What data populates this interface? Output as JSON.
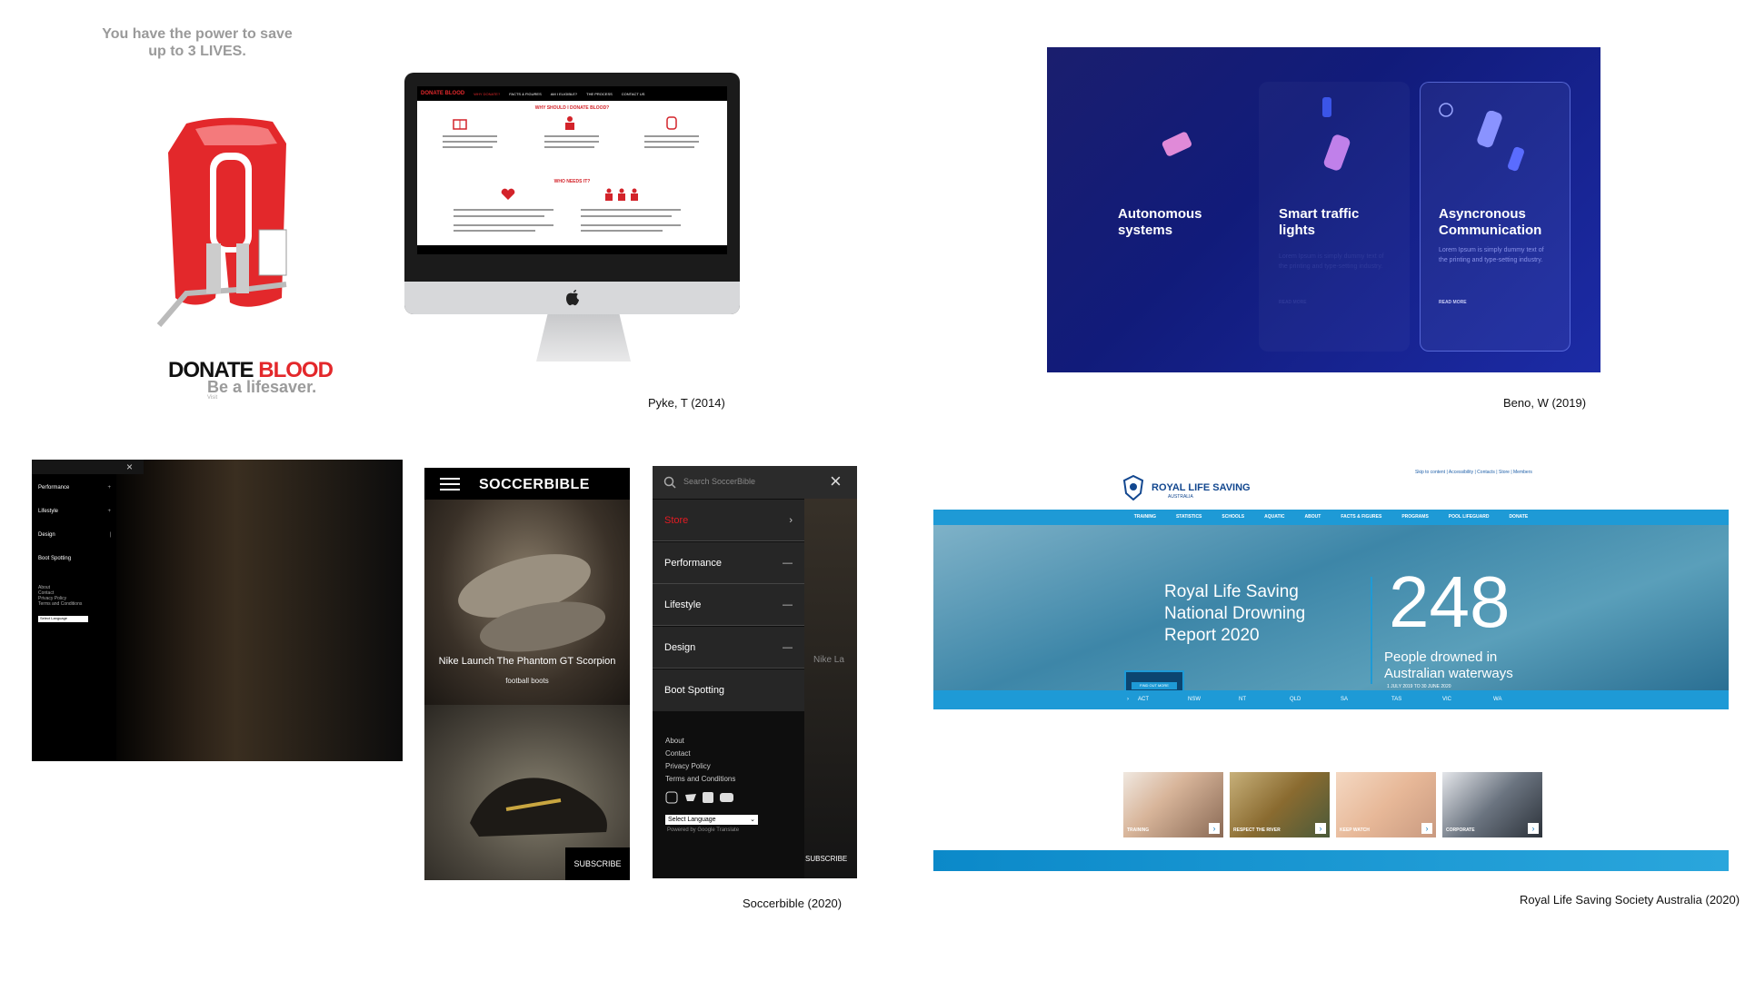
{
  "donate": {
    "tagline_line1": "You have the power to save",
    "tagline_line2": "up to 3 LIVES.",
    "logo_part1": "DONATE",
    "logo_part2": "BLOOD",
    "subtitle": "Be a lifesaver.",
    "visit": "Visit"
  },
  "pyke": {
    "caption": "Pyke, T (2014)",
    "screen_title": "WHY SHOULD I DONATE BLOOD?",
    "who_needs": "WHO NEEDS IT?",
    "nav_items": [
      "DONATE BLOOD",
      "WHY DONATE?",
      "FACTS & FIGURES",
      "AM I ELIGIBLE?",
      "THE PROCESS",
      "CONTACT US"
    ]
  },
  "beno": {
    "caption": "Beno, W (2019)",
    "cards": [
      {
        "title_line1": "Autonomous",
        "title_line2": "systems"
      },
      {
        "title_line1": "Smart traffic",
        "title_line2": "lights"
      },
      {
        "title_line1": "Asyncronous",
        "title_line2": "Communication",
        "body": "Lorem Ipsum is simply dummy text of the printing and type-setting industry.",
        "more": "READ MORE"
      }
    ],
    "card2_more": "READ MORE"
  },
  "dark_menu": {
    "items": [
      {
        "label": "Performance",
        "indicator": "+"
      },
      {
        "label": "Lifestyle",
        "indicator": "+"
      },
      {
        "label": "Design",
        "indicator": "|"
      },
      {
        "label": "Boot Spotting",
        "indicator": ""
      }
    ],
    "footer_links": [
      "About",
      "Contact",
      "Privacy Policy",
      "Terms and Conditions"
    ],
    "select_label": "Select Language"
  },
  "soccerbible": {
    "caption": "Soccerbible (2020)",
    "logo": "SOCCERBIBLE",
    "article_title": "Nike Launch The Phantom GT Scorpion",
    "article_tag": "football boots",
    "subscribe": "SUBSCRIBE",
    "search_placeholder": "Search SoccerBible",
    "menu_items": [
      {
        "label": "Store",
        "indicator": "›",
        "color": "#e31b23"
      },
      {
        "label": "Performance",
        "indicator": "—"
      },
      {
        "label": "Lifestyle",
        "indicator": "—"
      },
      {
        "label": "Design",
        "indicator": "—"
      },
      {
        "label": "Boot Spotting",
        "indicator": ""
      }
    ],
    "footer_links": [
      "About",
      "Contact",
      "Privacy Policy",
      "Terms and Conditions"
    ],
    "select_language": "Select Language",
    "powered_by": "Powered by Google Translate",
    "bg_peek_text": "Nike La",
    "menu_subscribe": "SUBSCRIBE"
  },
  "rls": {
    "caption": "Royal Life Saving Society Australia (2020)",
    "logo": "ROYAL LIFE SAVING",
    "logo_sub": "AUSTRALIA",
    "top_links": "Skip to content | Accessibility | Contacts | Store | Members",
    "nav": [
      "TRAINING",
      "STATISTICS",
      "SCHOOLS",
      "AQUATIC",
      "ABOUT",
      "FACTS & FIGURES",
      "PROGRAMS",
      "POOL LIFEGUARD",
      "DONATE"
    ],
    "hero_title_1": "Royal Life Saving",
    "hero_title_2": "National Drowning",
    "hero_title_3": "Report 2020",
    "hero_button": "FIND OUT MORE",
    "stat_number": "248",
    "stat_label_1": "People drowned in",
    "stat_label_2": "Australian waterways",
    "stat_date": "1 JULY 2019 TO 30 JUNE 2020",
    "states": [
      "ACT",
      "NSW",
      "NT",
      "QLD",
      "SA",
      "TAS",
      "VIC",
      "WA"
    ],
    "thumbs": [
      "TRAINING",
      "RESPECT THE RIVER",
      "KEEP WATCH",
      "CORPORATE"
    ]
  }
}
